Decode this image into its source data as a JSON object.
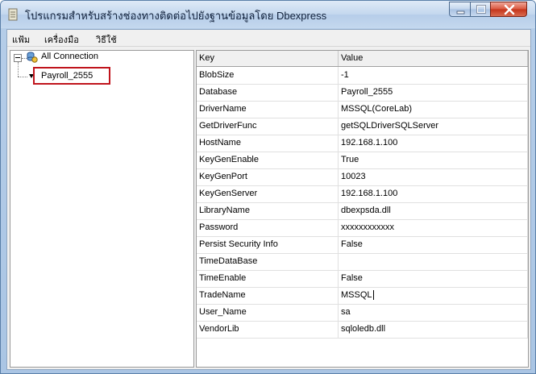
{
  "window": {
    "title": "โปรแกรมสำหรับสร้างช่องทางติดต่อไปยังฐานข้อมูลโดย Dbexpress"
  },
  "menu": {
    "items": [
      "แฟ้ม",
      "เครื่องมือ",
      "วิธีใช้"
    ]
  },
  "tree": {
    "root_label": "All Connection",
    "child_label": "Payroll_2555",
    "child_selected": true
  },
  "grid": {
    "columns": [
      "Key",
      "Value"
    ],
    "rows": [
      {
        "key": "BlobSize",
        "value": "-1"
      },
      {
        "key": "Database",
        "value": "Payroll_2555"
      },
      {
        "key": "DriverName",
        "value": "MSSQL(CoreLab)"
      },
      {
        "key": "GetDriverFunc",
        "value": "getSQLDriverSQLServer"
      },
      {
        "key": "HostName",
        "value": "192.168.1.100"
      },
      {
        "key": "KeyGenEnable",
        "value": "True"
      },
      {
        "key": "KeyGenPort",
        "value": "10023"
      },
      {
        "key": "KeyGenServer",
        "value": "192.168.1.100"
      },
      {
        "key": "LibraryName",
        "value": "dbexpsda.dll"
      },
      {
        "key": "Password",
        "value": "xxxxxxxxxxxx"
      },
      {
        "key": "Persist Security Info",
        "value": "False"
      },
      {
        "key": "TimeDataBase",
        "value": ""
      },
      {
        "key": "TimeEnable",
        "value": "False"
      },
      {
        "key": "TradeName",
        "value": "MSSQL"
      },
      {
        "key": "User_Name",
        "value": "sa"
      },
      {
        "key": "VendorLib",
        "value": "sqloledb.dll"
      }
    ],
    "editing_row": 13
  }
}
